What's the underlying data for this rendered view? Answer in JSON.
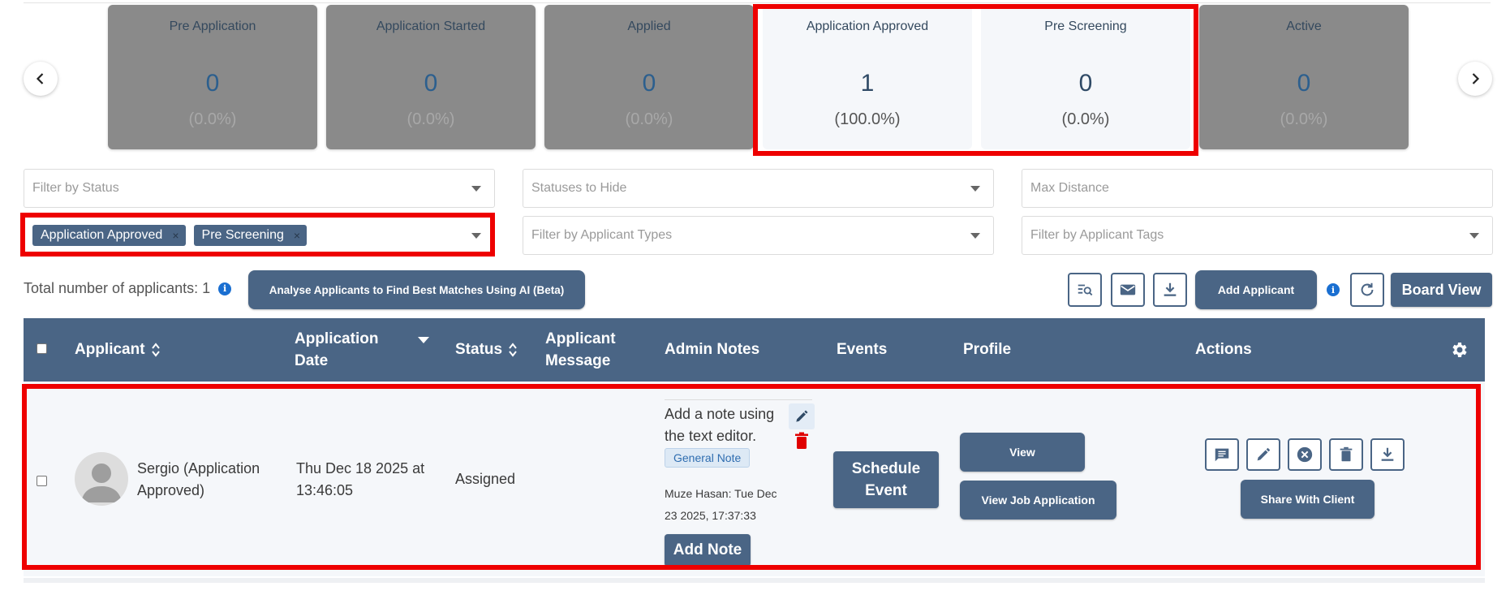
{
  "pipeline": {
    "cards": [
      {
        "title": "Pre Application",
        "count": "0",
        "percent": "(0.0%)"
      },
      {
        "title": "Application Started",
        "count": "0",
        "percent": "(0.0%)"
      },
      {
        "title": "Applied",
        "count": "0",
        "percent": "(0.0%)"
      },
      {
        "title": "Application Approved",
        "count": "1",
        "percent": "(100.0%)"
      },
      {
        "title": "Pre Screening",
        "count": "0",
        "percent": "(0.0%)"
      },
      {
        "title": "Active",
        "count": "0",
        "percent": "(0.0%)"
      }
    ],
    "prev_icon": "chevron-left-icon",
    "next_icon": "chevron-right-icon"
  },
  "filters": {
    "status_placeholder": "Filter by Status",
    "statuses_to_hide_placeholder": "Statuses to Hide",
    "max_distance_placeholder": "Max Distance",
    "applicant_types_placeholder": "Filter by Applicant Types",
    "applicant_tags_placeholder": "Filter by Applicant Tags",
    "selected_statuses": [
      "Application Approved",
      "Pre Screening"
    ],
    "chip_remove": "×"
  },
  "toolbar": {
    "total_label": "Total number of applicants: 1",
    "info": "i",
    "analyse_label": "Analyse Applicants to Find Best Matches Using AI (Beta)",
    "add_applicant_label": "Add Applicant",
    "board_view_label": "Board View"
  },
  "table": {
    "headers": {
      "applicant": "Applicant",
      "application_date_1": "Application",
      "application_date_2": "Date",
      "status": "Status",
      "applicant_message_1": "Applicant",
      "applicant_message_2": "Message",
      "admin_notes": "Admin Notes",
      "events": "Events",
      "profile": "Profile",
      "actions": "Actions"
    },
    "row": {
      "name_1": "Sergio (Application",
      "name_2": "Approved)",
      "date_1": "Thu Dec 18 2025 at",
      "date_2": "13:46:05",
      "status": "Assigned",
      "note_1": "Add a note using",
      "note_2": "the text editor.",
      "note_tag": "General Note",
      "note_meta_1": "Muze Hasan: Tue Dec",
      "note_meta_2": "23 2025, 17:37:33",
      "add_note_label": "Add Note",
      "schedule_1": "Schedule",
      "schedule_2": "Event",
      "view_label": "View",
      "view_job_label": "View Job Application",
      "share_label": "Share With Client"
    }
  },
  "colors": {
    "primary": "#4a6585",
    "highlight": "#ee0000",
    "inactive_card": "#8a8a8a"
  }
}
